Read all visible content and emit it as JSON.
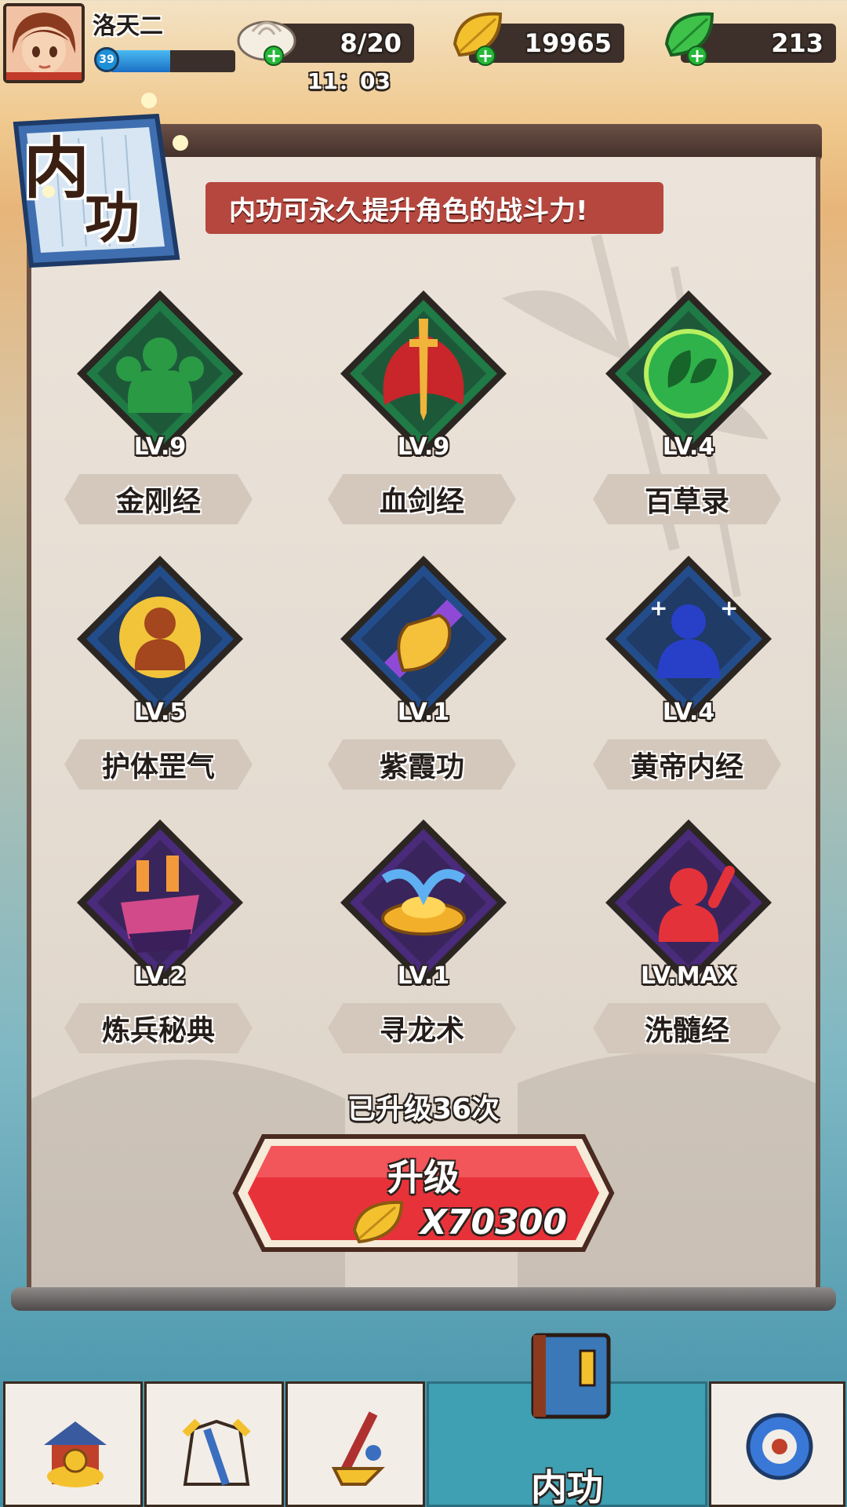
{
  "player": {
    "name": "洛天二",
    "level": "39",
    "xp_fraction": 0.48
  },
  "resources": {
    "stamina": {
      "value": "8/20",
      "timer": "11：03",
      "icon": "bun-icon"
    },
    "gold": {
      "value": "19965",
      "icon": "gold-leaf-icon"
    },
    "jade": {
      "value": "213",
      "icon": "jade-leaf-icon"
    }
  },
  "panel": {
    "title": "内功",
    "banner": "内功可永久提升角色的战斗力!"
  },
  "skills": [
    {
      "name": "金刚经",
      "level": "LV.9",
      "icon": "muscle-silhouette-icon",
      "frame": "#1f7a45"
    },
    {
      "name": "血剑经",
      "level": "LV.9",
      "icon": "blood-sword-icon",
      "frame": "#1f7a45"
    },
    {
      "name": "百草录",
      "level": "LV.4",
      "icon": "herb-leaf-icon",
      "frame": "#1f7a45"
    },
    {
      "name": "护体罡气",
      "level": "LV.5",
      "icon": "golden-aura-icon",
      "frame": "#234c8a"
    },
    {
      "name": "紫霞功",
      "level": "LV.1",
      "icon": "palm-strike-icon",
      "frame": "#234c8a"
    },
    {
      "name": "黄帝内经",
      "level": "LV.4",
      "icon": "healing-figure-icon",
      "frame": "#234c8a"
    },
    {
      "name": "炼兵秘典",
      "level": "LV.2",
      "icon": "forge-anvil-icon",
      "frame": "#4a2a7a"
    },
    {
      "name": "寻龙术",
      "level": "LV.1",
      "icon": "gold-ingot-icon",
      "frame": "#4a2a7a"
    },
    {
      "name": "洗髓经",
      "level": "LV.MAX",
      "icon": "red-spirit-icon",
      "frame": "#4a2a7a"
    }
  ],
  "upgrade": {
    "count_text": "已升级36次",
    "button_label": "升级",
    "cost": "X70300"
  },
  "nav": [
    {
      "icon": "treasure-shop-icon",
      "label": ""
    },
    {
      "icon": "robe-armor-icon",
      "label": ""
    },
    {
      "icon": "weapon-forge-icon",
      "label": ""
    },
    {
      "icon": "skill-book-icon",
      "label": "内功",
      "active": true
    },
    {
      "icon": "settings-gear-icon",
      "label": ""
    }
  ]
}
